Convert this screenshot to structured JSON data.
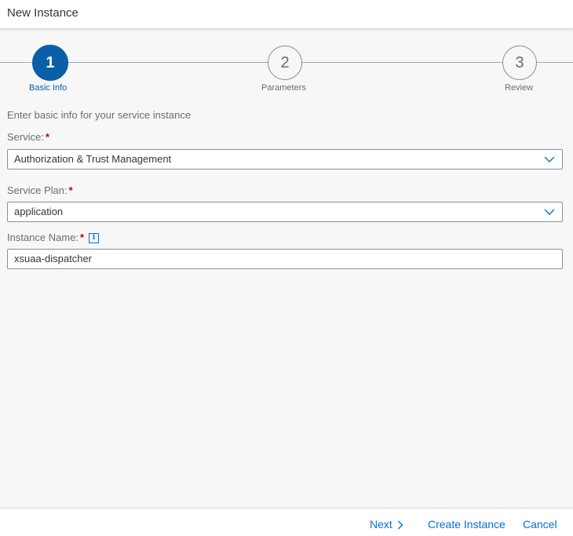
{
  "dialog": {
    "title": "New Instance"
  },
  "wizard": {
    "steps": [
      {
        "number": "1",
        "label": "Basic Info",
        "active": true
      },
      {
        "number": "2",
        "label": "Parameters",
        "active": false
      },
      {
        "number": "3",
        "label": "Review",
        "active": false
      }
    ]
  },
  "form": {
    "intro": "Enter basic info for your service instance",
    "service": {
      "label": "Service:",
      "required": "*",
      "value": "Authorization & Trust Management"
    },
    "plan": {
      "label": "Service Plan:",
      "required": "*",
      "value": "application"
    },
    "instance_name": {
      "label": "Instance Name:",
      "required": "*",
      "info_icon": "i",
      "value": "xsuaa-dispatcher"
    }
  },
  "footer": {
    "next": "Next",
    "create": "Create Instance",
    "cancel": "Cancel"
  },
  "colors": {
    "accent": "#0a5fa7",
    "link": "#0a6ed1",
    "required": "#bb0000"
  }
}
